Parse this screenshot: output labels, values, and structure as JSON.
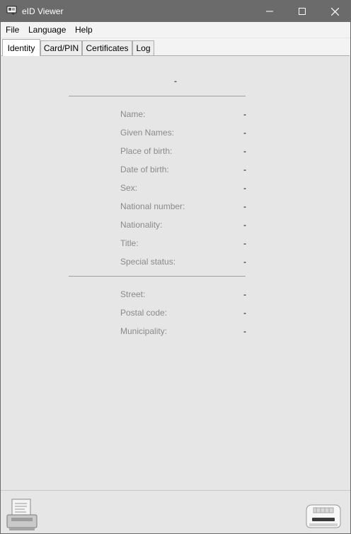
{
  "window": {
    "title": "eID Viewer"
  },
  "menu": {
    "file": "File",
    "language": "Language",
    "help": "Help"
  },
  "tabs": [
    "Identity",
    "Card/PIN",
    "Certificates",
    "Log"
  ],
  "identity": {
    "top_value": "-",
    "personal": [
      {
        "label": "Name:",
        "value": "-"
      },
      {
        "label": "Given Names:",
        "value": "-"
      },
      {
        "label": "Place of birth:",
        "value": "-"
      },
      {
        "label": "Date of birth:",
        "value": "-"
      },
      {
        "label": "Sex:",
        "value": "-"
      },
      {
        "label": "National number:",
        "value": "-"
      },
      {
        "label": "Nationality:",
        "value": "-"
      },
      {
        "label": "Title:",
        "value": "-"
      },
      {
        "label": "Special status:",
        "value": "-"
      }
    ],
    "address": [
      {
        "label": "Street:",
        "value": "-"
      },
      {
        "label": "Postal code:",
        "value": "-"
      },
      {
        "label": "Municipality:",
        "value": "-"
      }
    ]
  },
  "icons": {
    "app": "eid-card-icon",
    "print": "printer-icon",
    "reader": "card-reader-icon"
  }
}
